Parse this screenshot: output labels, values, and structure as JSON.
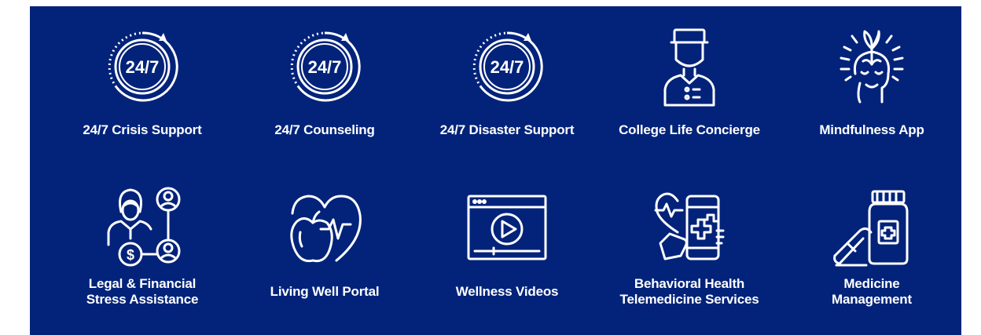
{
  "services": [
    {
      "label": "24/7 Crisis Support",
      "icon": "clock-24-7-icon",
      "badge": "24/7"
    },
    {
      "label": "24/7 Counseling",
      "icon": "clock-24-7-icon",
      "badge": "24/7"
    },
    {
      "label": "24/7 Disaster Support",
      "icon": "clock-24-7-icon",
      "badge": "24/7"
    },
    {
      "label": "College Life Concierge",
      "icon": "concierge-icon"
    },
    {
      "label": "Mindfulness App",
      "icon": "mindful-head-icon"
    },
    {
      "label_lines": [
        "Legal & Financial",
        "Stress Assistance"
      ],
      "icon": "legal-financial-icon"
    },
    {
      "label": "Living Well Portal",
      "icon": "heart-apple-icon"
    },
    {
      "label": "Wellness Videos",
      "icon": "video-player-icon"
    },
    {
      "label_lines": [
        "Behavioral Health",
        "Telemedicine Services"
      ],
      "icon": "telemedicine-icon"
    },
    {
      "label_lines": [
        "Medicine",
        "Management"
      ],
      "icon": "medicine-bottle-icon"
    }
  ],
  "colors": {
    "panel": "#03237a",
    "foreground": "#ffffff",
    "background": "#ffffff"
  }
}
